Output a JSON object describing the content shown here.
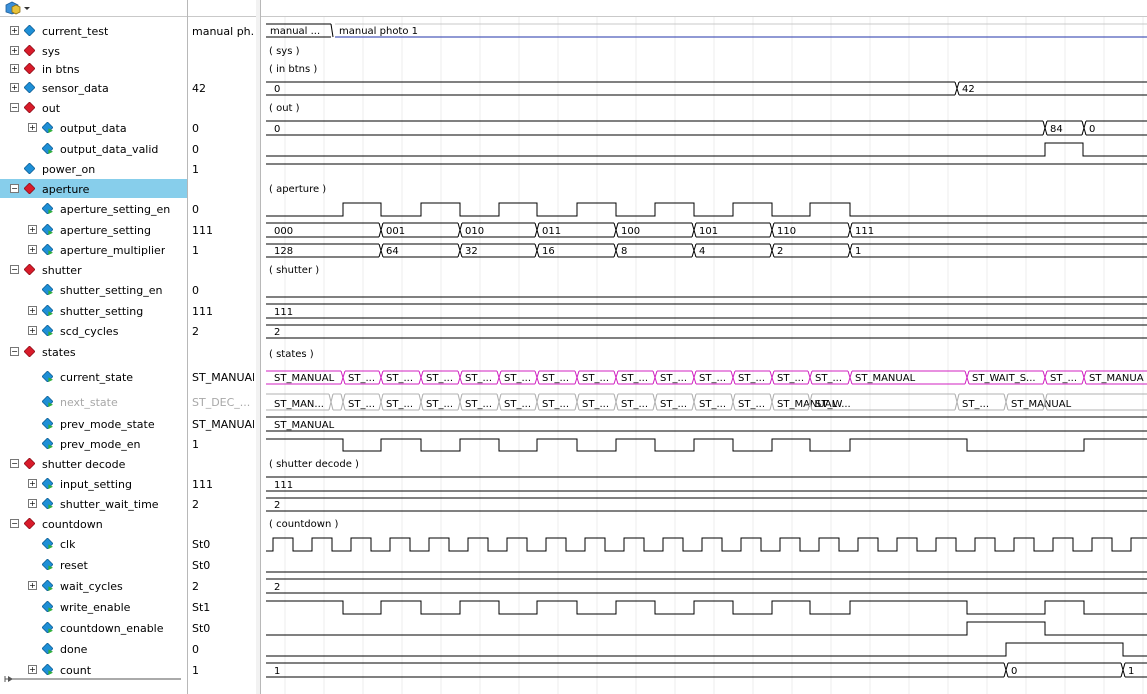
{
  "colors": {
    "group_icon": "#d81b2a",
    "signal_icon": "#1e8fd6",
    "selection": "#87ceeb",
    "trace": "#000000",
    "string_trace": "#2233aa",
    "state_trace": "#d020c0"
  },
  "toolbar": {
    "icon": "waveform-add-icon"
  },
  "signals": [
    {
      "name": "current_test",
      "value": "manual ph...",
      "kind": "sig",
      "expand": "+",
      "indent": 0
    },
    {
      "name": "sys",
      "value": "",
      "kind": "group",
      "expand": "+",
      "indent": 0
    },
    {
      "name": "in btns",
      "value": "",
      "kind": "group",
      "expand": "+",
      "indent": 0
    },
    {
      "name": "sensor_data",
      "value": "42",
      "kind": "sig",
      "expand": "+",
      "indent": 0
    },
    {
      "name": "out",
      "value": "",
      "kind": "group",
      "expand": "-",
      "indent": 0
    },
    {
      "name": "output_data",
      "value": "0",
      "kind": "sig",
      "expand": "+",
      "indent": 1
    },
    {
      "name": "output_data_valid",
      "value": "0",
      "kind": "sig",
      "expand": "",
      "indent": 1
    },
    {
      "name": "power_on",
      "value": "1",
      "kind": "sig",
      "expand": "",
      "indent": 0
    },
    {
      "name": "aperture",
      "value": "",
      "kind": "group",
      "expand": "-",
      "indent": 0,
      "selected": true
    },
    {
      "name": "aperture_setting_en",
      "value": "0",
      "kind": "sig",
      "expand": "",
      "indent": 1
    },
    {
      "name": "aperture_setting",
      "value": "111",
      "kind": "sig",
      "expand": "+",
      "indent": 1
    },
    {
      "name": "aperture_multiplier",
      "value": "1",
      "kind": "sig",
      "expand": "+",
      "indent": 1
    },
    {
      "name": "shutter",
      "value": "",
      "kind": "group",
      "expand": "-",
      "indent": 0
    },
    {
      "name": "shutter_setting_en",
      "value": "0",
      "kind": "sig",
      "expand": "",
      "indent": 1
    },
    {
      "name": "shutter_setting",
      "value": "111",
      "kind": "sig",
      "expand": "+",
      "indent": 1
    },
    {
      "name": "scd_cycles",
      "value": "2",
      "kind": "sig",
      "expand": "+",
      "indent": 1
    },
    {
      "name": "states",
      "value": "",
      "kind": "group",
      "expand": "-",
      "indent": 0
    },
    {
      "name": "current_state",
      "value": "ST_MANUAL",
      "kind": "sig",
      "expand": "",
      "indent": 1,
      "tall": true
    },
    {
      "name": "next_state",
      "value": "ST_DEC_...",
      "kind": "sig",
      "expand": "",
      "indent": 1,
      "dim": true
    },
    {
      "name": "prev_mode_state",
      "value": "ST_MANUAL",
      "kind": "sig",
      "expand": "",
      "indent": 1
    },
    {
      "name": "prev_mode_en",
      "value": "1",
      "kind": "sig",
      "expand": "",
      "indent": 1
    },
    {
      "name": "shutter decode",
      "value": "",
      "kind": "group",
      "expand": "-",
      "indent": 0
    },
    {
      "name": "input_setting",
      "value": "111",
      "kind": "sig",
      "expand": "+",
      "indent": 1
    },
    {
      "name": "shutter_wait_time",
      "value": "2",
      "kind": "sig",
      "expand": "+",
      "indent": 1
    },
    {
      "name": "countdown",
      "value": "",
      "kind": "group",
      "expand": "-",
      "indent": 0
    },
    {
      "name": "clk",
      "value": "St0",
      "kind": "sig",
      "expand": "",
      "indent": 1
    },
    {
      "name": "reset",
      "value": "St0",
      "kind": "sig",
      "expand": "",
      "indent": 1
    },
    {
      "name": "wait_cycles",
      "value": "2",
      "kind": "sig",
      "expand": "+",
      "indent": 1
    },
    {
      "name": "write_enable",
      "value": "St1",
      "kind": "sig",
      "expand": "",
      "indent": 1
    },
    {
      "name": "countdown_enable",
      "value": "St0",
      "kind": "sig",
      "expand": "",
      "indent": 1
    },
    {
      "name": "done",
      "value": "0",
      "kind": "sig",
      "expand": "",
      "indent": 1
    },
    {
      "name": "count",
      "value": "1",
      "kind": "sig",
      "expand": "+",
      "indent": 1
    }
  ],
  "wave_labels": {
    "current_test": [
      "manual ...",
      "manual photo 1"
    ],
    "sys": "( sys )",
    "in_btns": "( in btns )",
    "sensor_data": [
      "0",
      "42"
    ],
    "out": "( out )",
    "output_data": [
      "0",
      "84",
      "0"
    ],
    "aperture": "( aperture )",
    "aperture_setting": [
      "000",
      "001",
      "010",
      "011",
      "100",
      "101",
      "110",
      "111"
    ],
    "aperture_multiplier": [
      "128",
      "64",
      "32",
      "16",
      "8",
      "4",
      "2",
      "1"
    ],
    "shutter": "( shutter )",
    "shutter_setting": [
      "111"
    ],
    "scd_cycles": [
      "2"
    ],
    "states": "( states )",
    "current_state": [
      "ST_MANUAL",
      "ST_...",
      "ST_...",
      "ST_...",
      "ST_...",
      "ST_...",
      "ST_...",
      "ST_...",
      "ST_...",
      "ST_...",
      "ST_...",
      "ST_...",
      "ST_...",
      "ST_...",
      "ST_MANUAL",
      "ST_WAIT_S...",
      "ST_...",
      "ST_MANUA"
    ],
    "next_state": [
      "ST_MAN...",
      "",
      "ST_...",
      "ST_...",
      "ST_...",
      "ST_...",
      "ST_...",
      "ST_...",
      "ST_...",
      "ST_...",
      "ST_...",
      "ST_...",
      "ST_...",
      "ST_MANUAL",
      "ST_W...",
      "ST_...",
      "ST_MANUAL"
    ],
    "prev_mode_state": [
      "ST_MANUAL"
    ],
    "shutter_decode": "( shutter decode )",
    "input_setting": [
      "111"
    ],
    "shutter_wait_time": [
      "2"
    ],
    "countdown": "( countdown )",
    "wait_cycles": [
      "2"
    ],
    "count": [
      "1",
      "0",
      "1"
    ]
  }
}
